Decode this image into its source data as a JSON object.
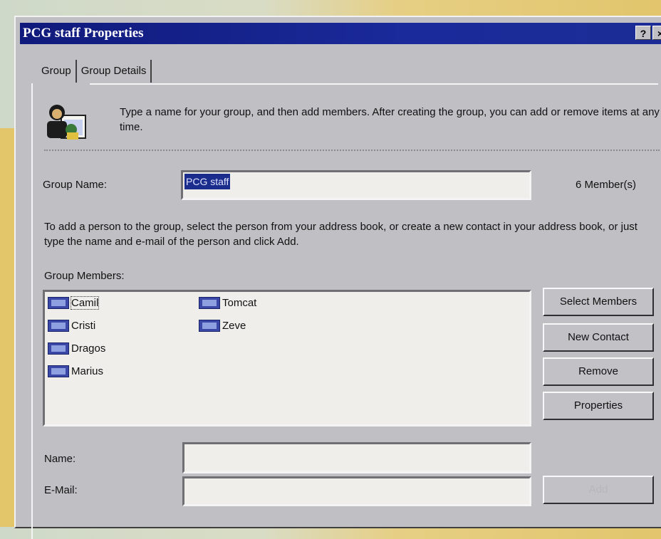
{
  "window": {
    "title": "PCG staff Properties",
    "help_glyph": "?",
    "close_glyph": "×"
  },
  "tabs": [
    {
      "label": "Group",
      "active": true
    },
    {
      "label": "Group Details",
      "active": false
    }
  ],
  "intro": {
    "icon": "group-icon",
    "text": "Type a name for your group, and then add members. After creating the group, you can add or remove items at any time."
  },
  "group_name": {
    "label": "Group Name:",
    "value": "PCG staff",
    "members_count": "6 Member(s)"
  },
  "instructions": "To add a person to the group, select the person from your address book, or create a new contact in your address book, or just type the name and e-mail of the person and click Add.",
  "members": {
    "label": "Group Members:",
    "items": [
      "Camil",
      "Cristi",
      "Dragos",
      "Marius",
      "Tomcat",
      "Zeve"
    ]
  },
  "buttons": {
    "select_members": "Select Members",
    "new_contact": "New Contact",
    "remove": "Remove",
    "properties": "Properties",
    "add": "Add"
  },
  "name_field": {
    "label": "Name:",
    "value": ""
  },
  "email_field": {
    "label": "E-Mail:",
    "value": ""
  },
  "colors": {
    "titlebar": "#101a7c",
    "face": "#c0c0c4",
    "selection": "#1a2c8c"
  }
}
